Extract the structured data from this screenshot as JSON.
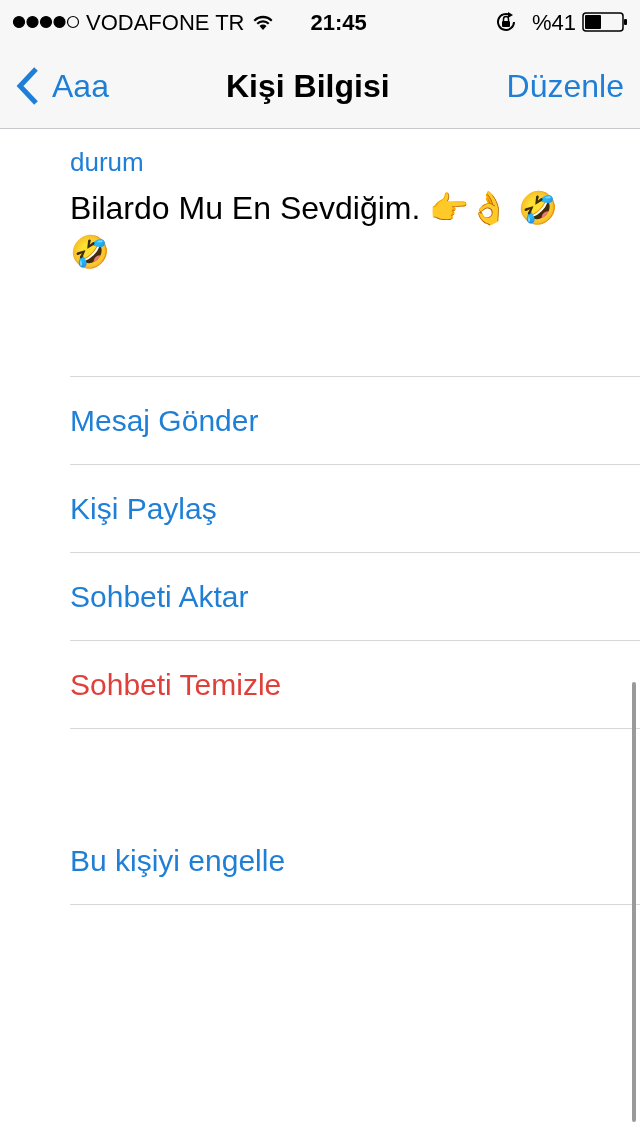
{
  "status_bar": {
    "carrier": "VODAFONE TR",
    "time": "21:45",
    "battery": "%41"
  },
  "nav": {
    "back": "Aaa",
    "title": "Kişi Bilgisi",
    "action": "Düzenle"
  },
  "about": {
    "label": "durum",
    "text": "Bilardo Mu En Sevdiğim. 👉👌 🤣 🤣"
  },
  "actions": [
    {
      "label": "Mesaj Gönder",
      "kind": "normal"
    },
    {
      "label": "Kişi Paylaş",
      "kind": "normal"
    },
    {
      "label": "Sohbeti Aktar",
      "kind": "normal"
    },
    {
      "label": "Sohbeti Temizle",
      "kind": "destructive"
    }
  ],
  "block": {
    "label": "Bu kişiyi engelle",
    "kind": "normal"
  }
}
